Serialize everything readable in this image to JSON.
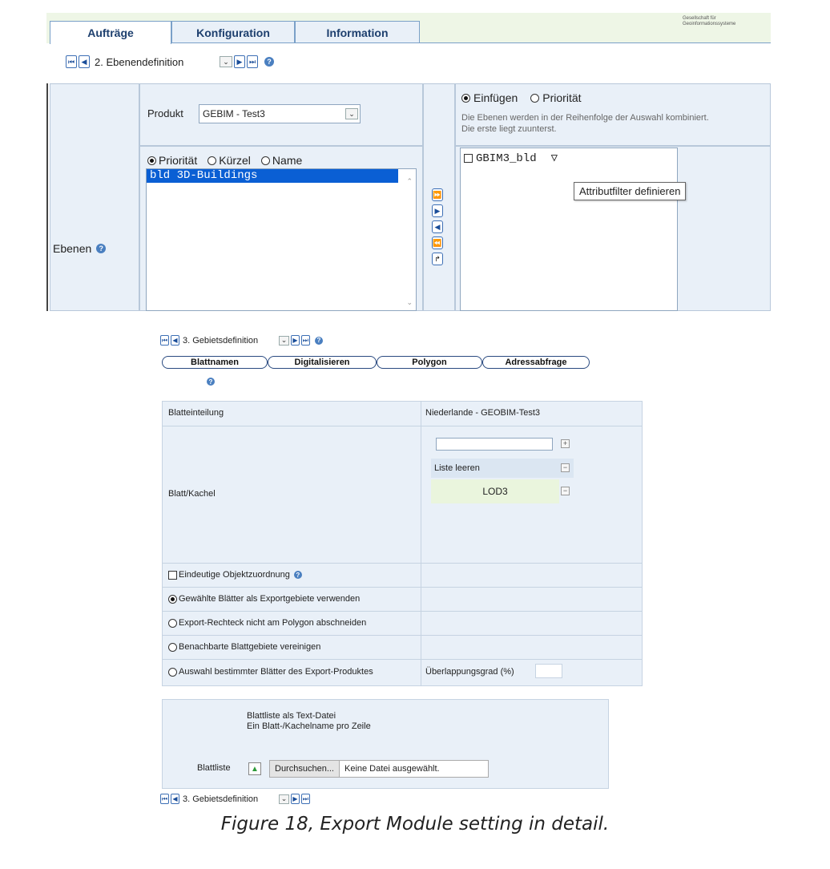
{
  "top": {
    "tabs": [
      "Aufträge",
      "Konfiguration",
      "Information"
    ],
    "logo_lines": [
      "Gesellschaft für",
      "Geoinformationssysteme"
    ],
    "step_select": "2. Ebenendefinition",
    "ebenen_label": "Ebenen",
    "produkt_label": "Produkt",
    "produkt_value": "GEBIM - Test3",
    "insert_options": [
      "Einfügen",
      "Priorität"
    ],
    "insert_help": [
      "Die Ebenen werden in der Reihenfolge der Auswahl kombiniert.",
      "Die erste liegt zuunterst."
    ],
    "sort_options": [
      "Priorität",
      "Kürzel",
      "Name"
    ],
    "available_layers": [
      "bld 3D-Buildings"
    ],
    "selected_layers": [
      "GBIM3_bld"
    ],
    "tooltip": "Attributfilter definieren",
    "move_buttons": [
      "⏩",
      "▶",
      "◀",
      "⏪",
      "↱"
    ]
  },
  "bottom": {
    "step_select": "3. Gebietsdefinition",
    "tabs": [
      "Blattnamen",
      "Digitalisieren",
      "Polygon",
      "Adressabfrage"
    ],
    "blatteinteilung_label": "Blatteinteilung",
    "blatteinteilung_value": "Niederlande - GEOBIM-Test3",
    "blatt_kachel_label": "Blatt/Kachel",
    "liste_leeren": "Liste leeren",
    "kachel_entries": [
      "LOD3"
    ],
    "eindeutige_label": "Eindeutige Objektzuordnung",
    "options": [
      {
        "label": "Gewählte Blätter als Exportgebiete verwenden",
        "checked": true
      },
      {
        "label": "Export-Rechteck nicht am Polygon abschneiden",
        "checked": false
      },
      {
        "label": "Benachbarte Blattgebiete vereinigen",
        "checked": false
      },
      {
        "label": "Auswahl bestimmter Blätter des Export-Produktes",
        "checked": false
      }
    ],
    "ueberlappung_label": "Überlappungsgrad (%)",
    "blattliste_info": [
      "Blattliste als Text-Datei",
      "Ein Blatt-/Kachelname pro Zeile"
    ],
    "blattliste_label": "Blattliste",
    "browse_button": "Durchsuchen...",
    "no_file": "Keine Datei ausgewählt.",
    "footer_step_select": "3. Gebietsdefinition"
  },
  "caption": "Figure 18, Export Module setting in detail."
}
